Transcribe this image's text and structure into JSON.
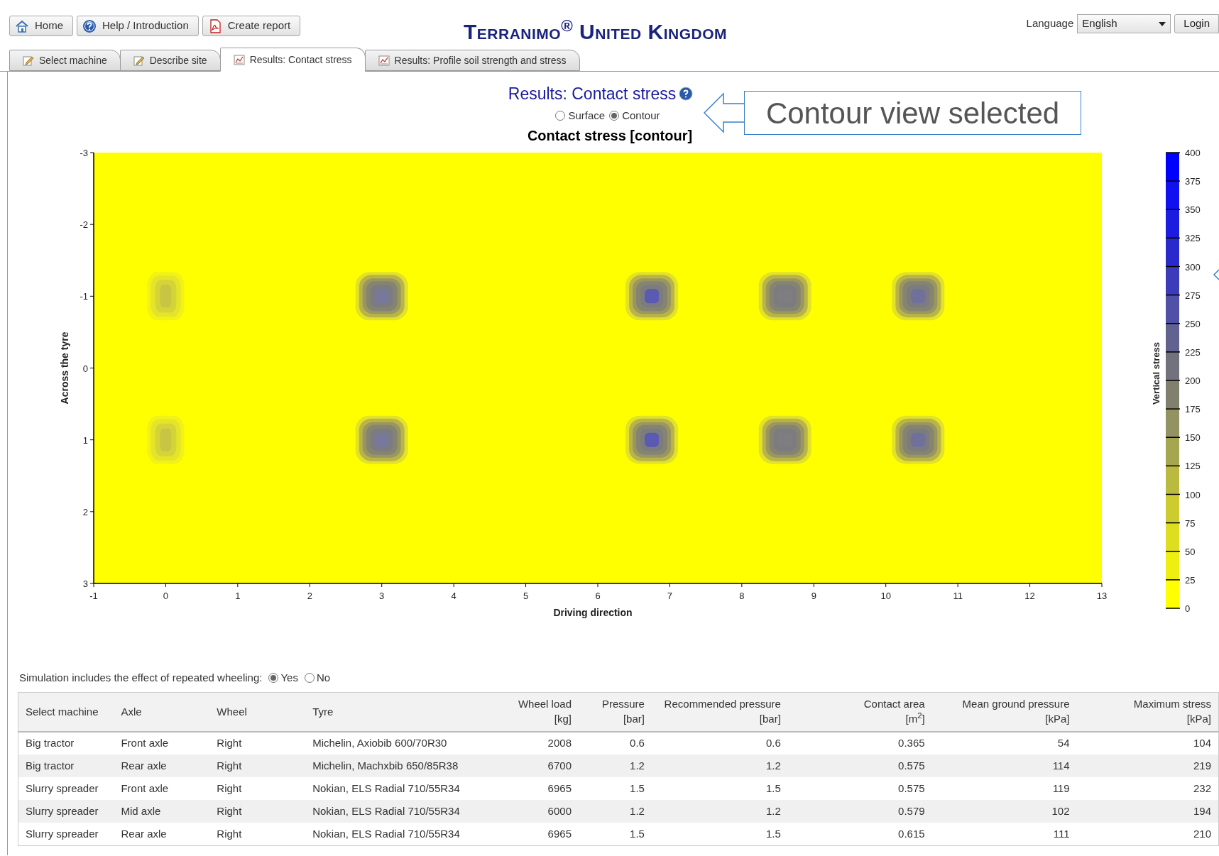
{
  "toolbar": {
    "buttons": [
      {
        "kind": "home",
        "label": "Home"
      },
      {
        "kind": "help",
        "label": "Help / Introduction"
      },
      {
        "kind": "report",
        "label": "Create report"
      }
    ]
  },
  "app_title": "Terranimo$^{®}$ United Kingdom",
  "language": {
    "label": "Language",
    "value": "English"
  },
  "login": {
    "label": "Login"
  },
  "tabs": [
    {
      "label": "Select machine",
      "selected": false,
      "kind": "edit"
    },
    {
      "label": "Describe site",
      "selected": false,
      "kind": "edit"
    },
    {
      "label": "Results: Contact stress",
      "selected": true,
      "kind": "chart"
    },
    {
      "label": "Results: Profile soil strength and stress",
      "selected": false,
      "kind": "chart"
    }
  ],
  "results": {
    "title": "Results: Contact stress",
    "view_options": [
      {
        "label": "Surface",
        "selected": false
      },
      {
        "label": "Contour",
        "selected": true
      }
    ],
    "callout": "Contour view selected",
    "contour_plot": {
      "title": "Contact stress [contour]",
      "xlabel": "Driving direction",
      "ylabel": "Across the tyre",
      "xticks": [
        "-1",
        "0",
        "1",
        "2",
        "3",
        "4",
        "5",
        "6",
        "7",
        "8",
        "9",
        "10",
        "11",
        "12",
        "13"
      ],
      "yticks": [
        "-3",
        "-2",
        "-1",
        "0",
        "1",
        "2",
        "3"
      ],
      "colorbar": {
        "label": "Vertical stress",
        "ticks": [
          "400",
          "375",
          "350",
          "325",
          "300",
          "275",
          "250",
          "225",
          "200",
          "175",
          "150",
          "125",
          "100",
          "75",
          "50",
          "25",
          "0"
        ]
      }
    }
  },
  "repeated_wheeling": {
    "label": "Simulation includes the effect of repeated wheeling:",
    "options": [
      {
        "label": "Yes",
        "selected": true
      },
      {
        "label": "No",
        "selected": false
      }
    ]
  },
  "table": {
    "columns": [
      {
        "label": "Select machine"
      },
      {
        "label": "Axle"
      },
      {
        "label": "Wheel"
      },
      {
        "label": "Tyre"
      },
      {
        "label": "Wheel load",
        "unit": "[kg]"
      },
      {
        "label": "Pressure",
        "unit": "[bar]"
      },
      {
        "label": "Recommended pressure",
        "unit": "[bar]"
      },
      {
        "label": "Contact area",
        "unit": "[m$^{2}$]"
      },
      {
        "label": "Mean ground pressure",
        "unit": "[kPa]"
      },
      {
        "label": "Maximum stress",
        "unit": "[kPa]"
      }
    ],
    "rows": [
      [
        "Big tractor",
        "Front axle",
        "Right",
        "Michelin, Axiobib 600/70R30",
        "2008",
        "0.6",
        "0.6",
        "0.365",
        "54",
        "104"
      ],
      [
        "Big tractor",
        "Rear axle",
        "Right",
        "Michelin, Machxbib 650/85R38",
        "6700",
        "1.2",
        "1.2",
        "0.575",
        "114",
        "219"
      ],
      [
        "Slurry spreader",
        "Front axle",
        "Right",
        "Nokian, ELS Radial 710/55R34",
        "6965",
        "1.5",
        "1.5",
        "0.575",
        "119",
        "232"
      ],
      [
        "Slurry spreader",
        "Mid axle",
        "Right",
        "Nokian, ELS Radial 710/55R34",
        "6000",
        "1.2",
        "1.2",
        "0.579",
        "102",
        "194"
      ],
      [
        "Slurry spreader",
        "Rear axle",
        "Right",
        "Nokian, ELS Radial 710/55R34",
        "6965",
        "1.5",
        "1.5",
        "0.615",
        "111",
        "210"
      ]
    ]
  }
}
